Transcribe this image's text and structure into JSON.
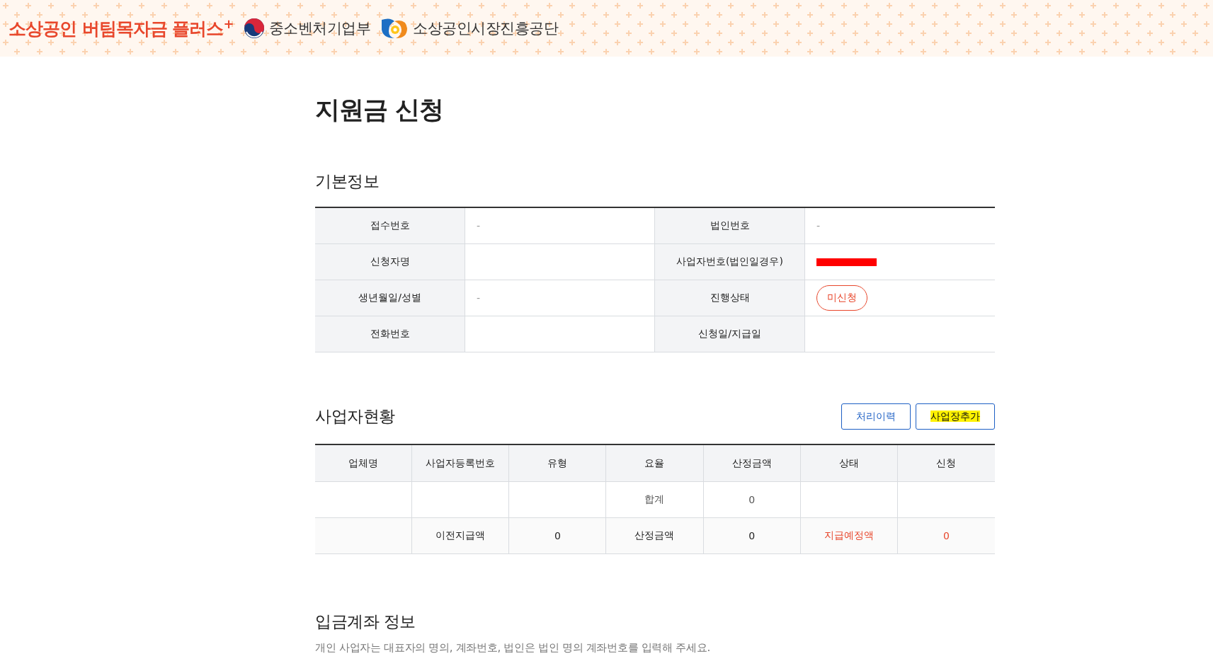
{
  "header": {
    "title": "소상공인 버팀목자금 플러스",
    "title_sup": "+",
    "ministry": "중소벤처기업부",
    "agency": "소상공인시장진흥공단"
  },
  "page_title": "지원금 신청",
  "basic_info": {
    "heading": "기본정보",
    "fields": [
      {
        "label": "접수번호",
        "kind": "text",
        "value": "-"
      },
      {
        "label": "법인번호",
        "kind": "text",
        "value": "-"
      },
      {
        "label": "신청자명",
        "kind": "text"
      },
      {
        "label": "사업자번호(법인일경우)",
        "kind": "redacted"
      },
      {
        "label": "생년월일/성별",
        "kind": "text",
        "value": "-"
      },
      {
        "label": "진행상태",
        "kind": "status",
        "value": "미신청"
      },
      {
        "label": "전화번호",
        "kind": "text"
      },
      {
        "label": "신청일/지급일",
        "kind": "text"
      }
    ]
  },
  "business_status": {
    "heading": "사업자현황",
    "buttons": [
      {
        "label": "처리이력",
        "highlighted": false
      },
      {
        "label": "사업장추가",
        "highlighted": true
      }
    ],
    "columns": [
      "업체명",
      "사업자등록번호",
      "유형",
      "요율",
      "산정금액",
      "상태",
      "신청"
    ],
    "total_row": {
      "label": "합계",
      "amount": "0"
    },
    "payment_row": {
      "previous_label": "이전지급액",
      "previous_amount": "0",
      "calculated_label": "산정금액",
      "calculated_amount": "0",
      "scheduled_label": "지급예정액",
      "scheduled_amount": "0"
    }
  },
  "account_info": {
    "heading": "입금계좌 정보",
    "description": "개인 사업자는 대표자의 명의, 계좌번호, 법인은 법인 명의 계좌번호를 입력해 주세요."
  }
}
